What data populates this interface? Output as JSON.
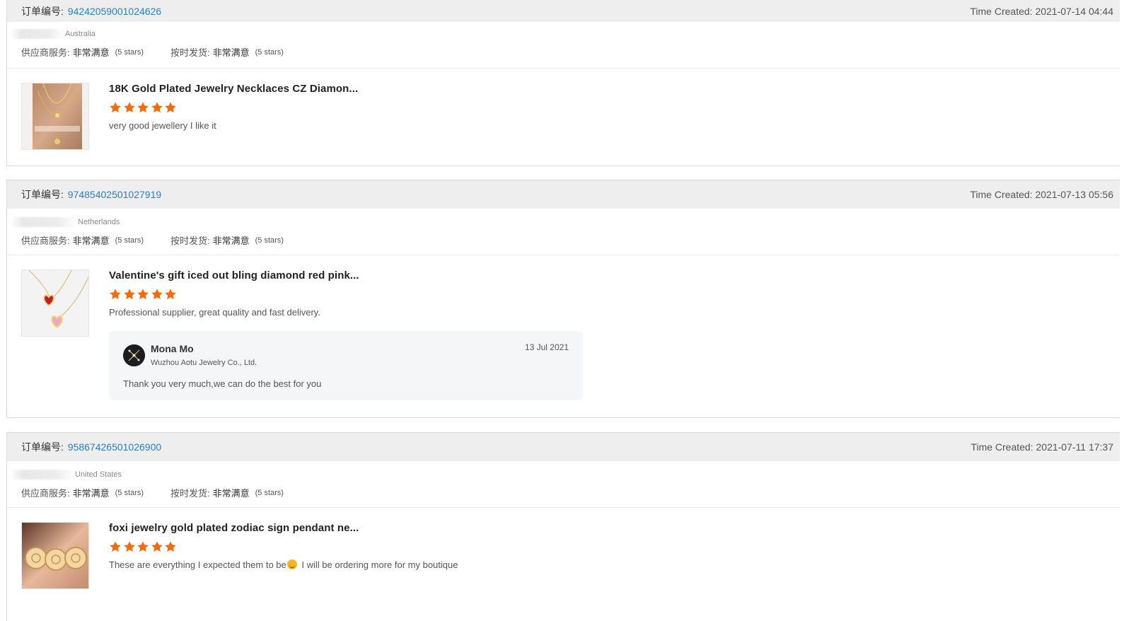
{
  "labels": {
    "order_no": "订单编号:",
    "time_created": "Time Created: ",
    "supplier_service": "供应商服务:",
    "on_time_shipping": "按时发货:"
  },
  "colors": {
    "star": "#f26c0d",
    "link": "#2a7fc1",
    "header_bg": "#eeeeee"
  },
  "orders": [
    {
      "order_no": "94242059001024626",
      "time_created": "2021-07-14 04:44",
      "buyer_country": "Australia",
      "supplier_service": {
        "value": "非常满意",
        "stars_text": "(5 stars)",
        "stars": 5
      },
      "on_time_shipping": {
        "value": "非常满意",
        "stars_text": "(5 stars)",
        "stars": 5
      },
      "product": {
        "title": "18K Gold Plated Jewelry Necklaces CZ Diamon...",
        "rating": 5,
        "review": "very good jewellery I like it",
        "image": "gold-necklace-on-wrist-photo"
      }
    },
    {
      "order_no": "97485402501027919",
      "time_created": "2021-07-13 05:56",
      "buyer_country": "Netherlands",
      "supplier_service": {
        "value": "非常满意",
        "stars_text": "(5 stars)",
        "stars": 5
      },
      "on_time_shipping": {
        "value": "非常满意",
        "stars_text": "(5 stars)",
        "stars": 5
      },
      "product": {
        "title": "Valentine's gift iced out bling diamond red pink...",
        "rating": 5,
        "review": "Professional supplier, great quality and fast delivery.",
        "image": "heart-pendant-necklaces-photo"
      },
      "reply": {
        "name": "Mona Mo",
        "company": "Wuzhou Aotu Jewelry Co., Ltd.",
        "date": "13 Jul 2021",
        "text": "Thank you very much,we can do the best for you"
      }
    },
    {
      "order_no": "95867426501026900",
      "time_created": "2021-07-11 17:37",
      "buyer_country": "United States",
      "supplier_service": {
        "value": "非常满意",
        "stars_text": "(5 stars)",
        "stars": 5
      },
      "on_time_shipping": {
        "value": "非常满意",
        "stars_text": "(5 stars)",
        "stars": 5
      },
      "product": {
        "title": "foxi jewelry gold plated zodiac sign pendant ne...",
        "rating": 5,
        "review_before": "These are everything I expected them to be",
        "review_after": " I will be ordering more for my boutique",
        "image": "zodiac-pendants-in-hand-photo"
      }
    }
  ]
}
